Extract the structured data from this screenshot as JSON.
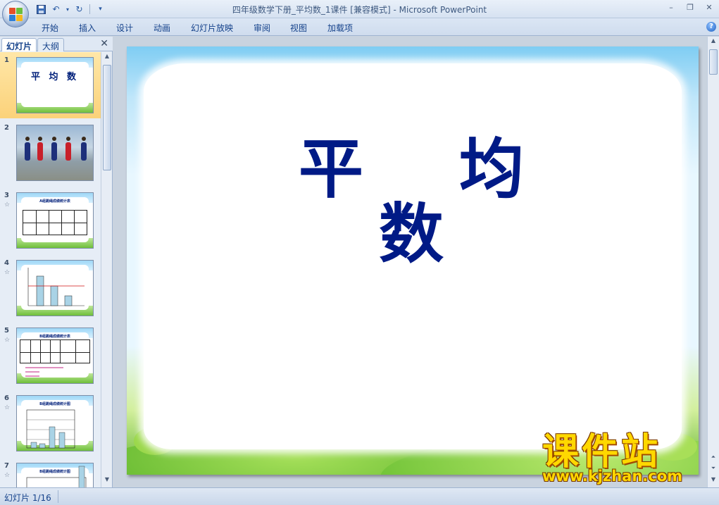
{
  "window": {
    "title": "四年级数学下册_平均数_1课件 [兼容模式] - Microsoft PowerPoint"
  },
  "ribbon": {
    "tabs": [
      "开始",
      "插入",
      "设计",
      "动画",
      "幻灯片放映",
      "审阅",
      "视图",
      "加载项"
    ]
  },
  "panel": {
    "tab_slides": "幻灯片",
    "tab_outline": "大纲"
  },
  "thumbnails": [
    {
      "num": "1",
      "title": "平 均 数",
      "selected": true
    },
    {
      "num": "2"
    },
    {
      "num": "3",
      "heading": "A组跳绳成绩统计表"
    },
    {
      "num": "4"
    },
    {
      "num": "5",
      "heading": "B组跳绳成绩统计表"
    },
    {
      "num": "6",
      "heading": "B组跳绳成绩统计图"
    },
    {
      "num": "7",
      "heading": "B组跳绳成绩统计图"
    }
  ],
  "slide": {
    "title": "平 均 数"
  },
  "watermark": {
    "brand": "课件站",
    "url": "www.kjzhan.com"
  },
  "status": {
    "slide_counter": "幻灯片 1/16"
  },
  "colors": {
    "title_blue": "#001a86",
    "watermark_yellow": "#ffd800"
  }
}
